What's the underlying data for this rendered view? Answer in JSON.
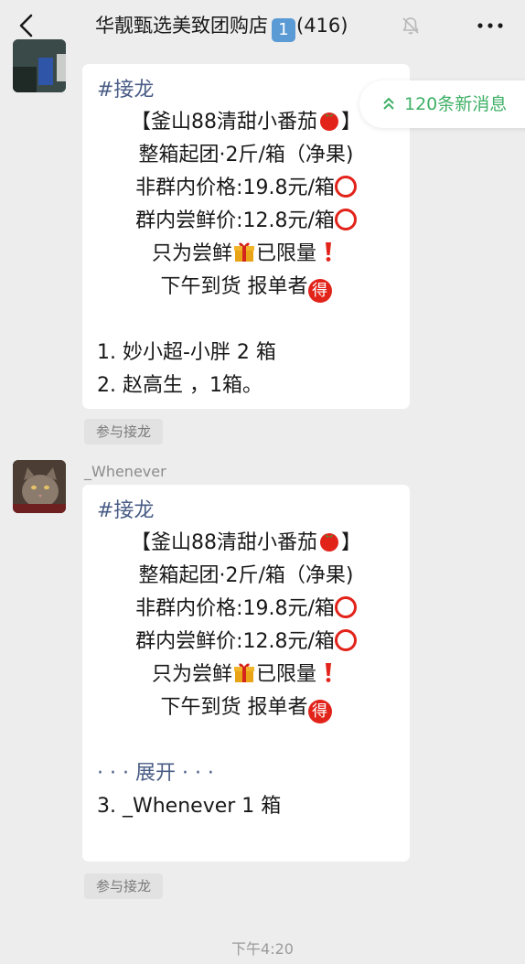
{
  "header": {
    "title": "华靓甄选美致团购店",
    "badge": "1",
    "count": "(416)"
  },
  "new_messages": {
    "label": "120条新消息"
  },
  "messages": [
    {
      "tag": "#接龙",
      "lines": [
        "【釜山88清甜小番茄",
        "】",
        "整箱起团·2斤/箱（净果)",
        "非群内价格:19.8元/箱",
        "群内尝鲜价:12.8元/箱",
        "只为尝鲜",
        "已限量",
        "下午到货  报单者"
      ],
      "items": [
        "1. 妙小超-小胖 2 箱",
        "2. 赵高生 ，1箱。"
      ],
      "join_label": "参与接龙"
    },
    {
      "sender": "_Whenever",
      "tag": "#接龙",
      "lines": [
        "【釜山88清甜小番茄",
        "】",
        "整箱起团·2斤/箱（净果)",
        "非群内价格:19.8元/箱",
        "群内尝鲜价:12.8元/箱",
        "只为尝鲜",
        "已限量",
        "下午到货  报单者"
      ],
      "expand": "· · · 展开 · · ·",
      "items": [
        "3. _Whenever 1 箱"
      ],
      "join_label": "参与接龙"
    }
  ],
  "de_char": "得",
  "timestamp": "下午4:20",
  "colors": {
    "background": "#ededed",
    "bubble": "#ffffff",
    "link_blue": "#4a5d86",
    "new_msg_green": "#3fb066",
    "emoji_red": "#e2231a"
  },
  "icons": [
    "back-arrow-icon",
    "mute-bell-icon",
    "more-icon",
    "tomato-icon",
    "red-circle-icon",
    "gift-icon",
    "exclamation-icon",
    "de-badge-icon",
    "double-chevron-up-icon"
  ]
}
